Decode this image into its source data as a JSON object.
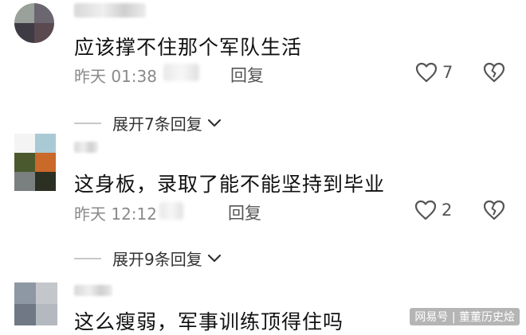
{
  "comments": [
    {
      "text": "应该撑不住那个军队生活",
      "time": "昨天 01:38",
      "reply_label": "回复",
      "like_count": "7",
      "expand_label": "展开7条回复"
    },
    {
      "text": "这身板，录取了能不能坚持到毕业",
      "time": "昨天 12:12",
      "reply_label": "回复",
      "like_count": "2",
      "expand_label": "展开9条回复"
    },
    {
      "text": "这么瘦弱，军事训练顶得住吗"
    }
  ],
  "watermark": "网易号 | 董董历史烩",
  "icons": {
    "like": "heart-outline-icon",
    "dislike": "broken-heart-icon",
    "expand": "chevron-down-icon"
  }
}
